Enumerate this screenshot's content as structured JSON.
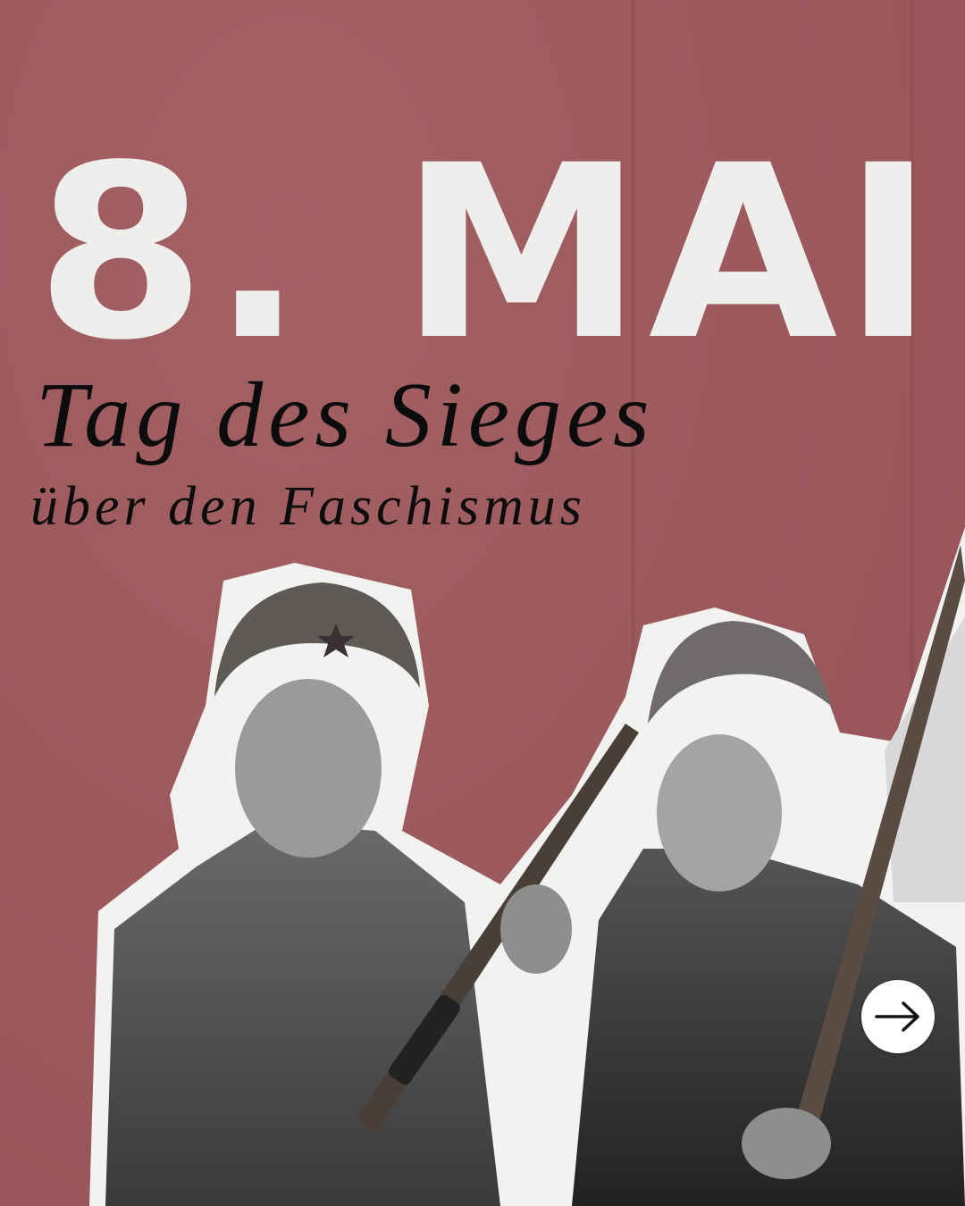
{
  "poster": {
    "headline": "8. MAI",
    "subtitle_line1": "Tag des Sieges",
    "subtitle_line2": "über den Faschismus"
  },
  "photo": {
    "subject": "two women soldiers with rifles, black-and-white cutout"
  },
  "controls": {
    "next_icon": "arrow-right-icon"
  },
  "colors": {
    "background": "#9d5b5d",
    "headline": "#eeeeec",
    "subtitle": "#0c0c0c"
  }
}
